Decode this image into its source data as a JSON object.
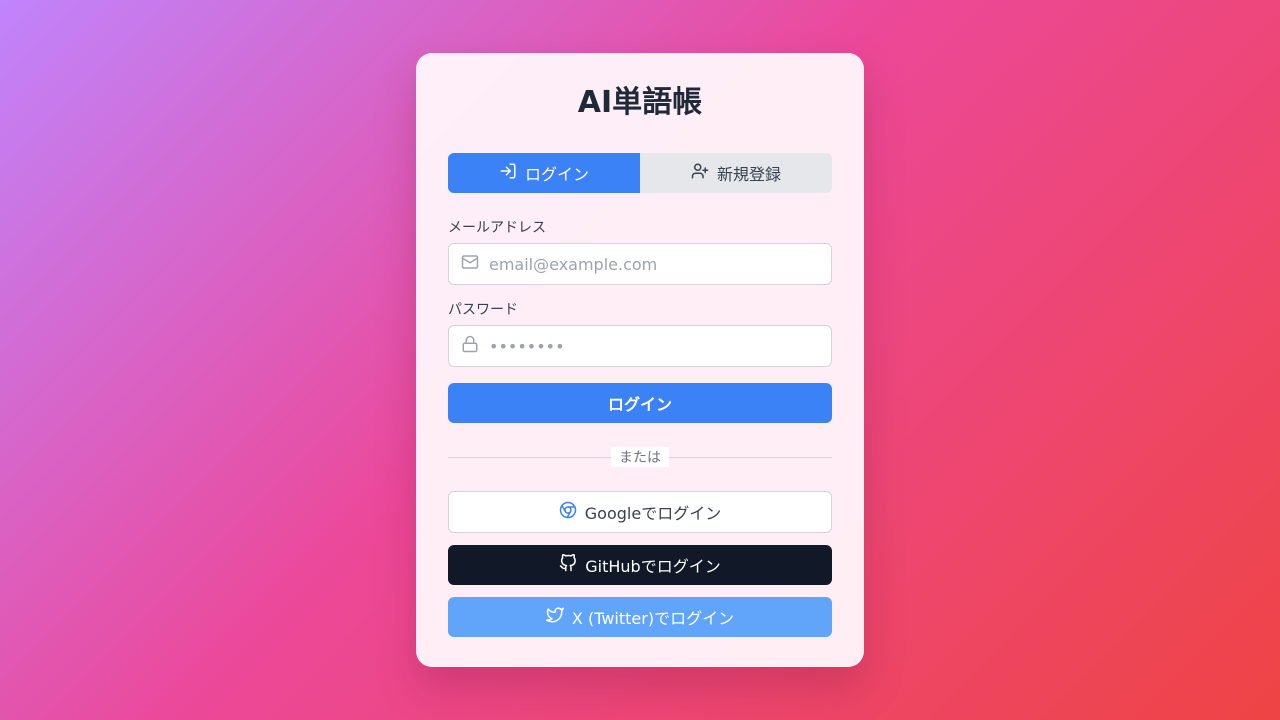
{
  "app": {
    "title": "AI単語帳"
  },
  "tabs": [
    {
      "label": "ログイン",
      "icon": "login-icon",
      "active": true
    },
    {
      "label": "新規登録",
      "icon": "user-plus-icon",
      "active": false
    }
  ],
  "form": {
    "email": {
      "label": "メールアドレス",
      "placeholder": "email@example.com",
      "value": "",
      "icon": "mail-icon"
    },
    "password": {
      "label": "パスワード",
      "placeholder": "••••••••",
      "value": "",
      "icon": "lock-icon"
    },
    "submit_label": "ログイン"
  },
  "divider_text": "または",
  "social": {
    "google": {
      "label": "Googleでログイン",
      "icon": "chrome-icon"
    },
    "github": {
      "label": "GitHubでログイン",
      "icon": "github-icon"
    },
    "twitter": {
      "label": "X (Twitter)でログイン",
      "icon": "twitter-icon"
    }
  },
  "colors": {
    "primary": "#3b82f6",
    "github_bg": "#111827",
    "twitter_bg": "#60a5fa",
    "background_gradient": [
      "#c084fc",
      "#ec4899",
      "#ef4444"
    ]
  }
}
